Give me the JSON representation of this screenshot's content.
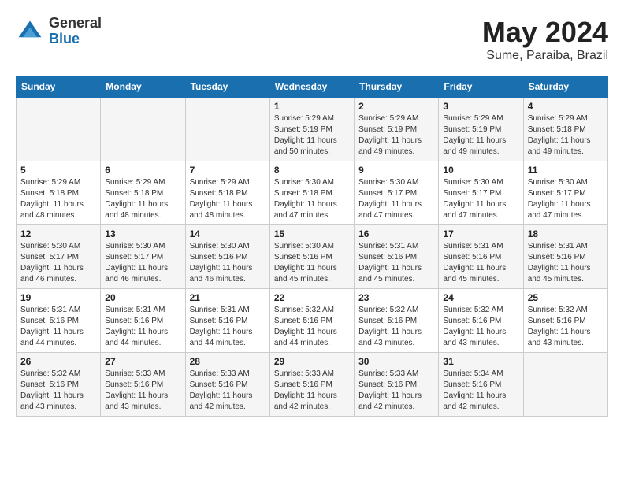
{
  "header": {
    "logo_general": "General",
    "logo_blue": "Blue",
    "month_title": "May 2024",
    "location": "Sume, Paraiba, Brazil"
  },
  "days_of_week": [
    "Sunday",
    "Monday",
    "Tuesday",
    "Wednesday",
    "Thursday",
    "Friday",
    "Saturday"
  ],
  "weeks": [
    [
      {
        "day": "",
        "info": ""
      },
      {
        "day": "",
        "info": ""
      },
      {
        "day": "",
        "info": ""
      },
      {
        "day": "1",
        "info": "Sunrise: 5:29 AM\nSunset: 5:19 PM\nDaylight: 11 hours\nand 50 minutes."
      },
      {
        "day": "2",
        "info": "Sunrise: 5:29 AM\nSunset: 5:19 PM\nDaylight: 11 hours\nand 49 minutes."
      },
      {
        "day": "3",
        "info": "Sunrise: 5:29 AM\nSunset: 5:19 PM\nDaylight: 11 hours\nand 49 minutes."
      },
      {
        "day": "4",
        "info": "Sunrise: 5:29 AM\nSunset: 5:18 PM\nDaylight: 11 hours\nand 49 minutes."
      }
    ],
    [
      {
        "day": "5",
        "info": "Sunrise: 5:29 AM\nSunset: 5:18 PM\nDaylight: 11 hours\nand 48 minutes."
      },
      {
        "day": "6",
        "info": "Sunrise: 5:29 AM\nSunset: 5:18 PM\nDaylight: 11 hours\nand 48 minutes."
      },
      {
        "day": "7",
        "info": "Sunrise: 5:29 AM\nSunset: 5:18 PM\nDaylight: 11 hours\nand 48 minutes."
      },
      {
        "day": "8",
        "info": "Sunrise: 5:30 AM\nSunset: 5:18 PM\nDaylight: 11 hours\nand 47 minutes."
      },
      {
        "day": "9",
        "info": "Sunrise: 5:30 AM\nSunset: 5:17 PM\nDaylight: 11 hours\nand 47 minutes."
      },
      {
        "day": "10",
        "info": "Sunrise: 5:30 AM\nSunset: 5:17 PM\nDaylight: 11 hours\nand 47 minutes."
      },
      {
        "day": "11",
        "info": "Sunrise: 5:30 AM\nSunset: 5:17 PM\nDaylight: 11 hours\nand 47 minutes."
      }
    ],
    [
      {
        "day": "12",
        "info": "Sunrise: 5:30 AM\nSunset: 5:17 PM\nDaylight: 11 hours\nand 46 minutes."
      },
      {
        "day": "13",
        "info": "Sunrise: 5:30 AM\nSunset: 5:17 PM\nDaylight: 11 hours\nand 46 minutes."
      },
      {
        "day": "14",
        "info": "Sunrise: 5:30 AM\nSunset: 5:16 PM\nDaylight: 11 hours\nand 46 minutes."
      },
      {
        "day": "15",
        "info": "Sunrise: 5:30 AM\nSunset: 5:16 PM\nDaylight: 11 hours\nand 45 minutes."
      },
      {
        "day": "16",
        "info": "Sunrise: 5:31 AM\nSunset: 5:16 PM\nDaylight: 11 hours\nand 45 minutes."
      },
      {
        "day": "17",
        "info": "Sunrise: 5:31 AM\nSunset: 5:16 PM\nDaylight: 11 hours\nand 45 minutes."
      },
      {
        "day": "18",
        "info": "Sunrise: 5:31 AM\nSunset: 5:16 PM\nDaylight: 11 hours\nand 45 minutes."
      }
    ],
    [
      {
        "day": "19",
        "info": "Sunrise: 5:31 AM\nSunset: 5:16 PM\nDaylight: 11 hours\nand 44 minutes."
      },
      {
        "day": "20",
        "info": "Sunrise: 5:31 AM\nSunset: 5:16 PM\nDaylight: 11 hours\nand 44 minutes."
      },
      {
        "day": "21",
        "info": "Sunrise: 5:31 AM\nSunset: 5:16 PM\nDaylight: 11 hours\nand 44 minutes."
      },
      {
        "day": "22",
        "info": "Sunrise: 5:32 AM\nSunset: 5:16 PM\nDaylight: 11 hours\nand 44 minutes."
      },
      {
        "day": "23",
        "info": "Sunrise: 5:32 AM\nSunset: 5:16 PM\nDaylight: 11 hours\nand 43 minutes."
      },
      {
        "day": "24",
        "info": "Sunrise: 5:32 AM\nSunset: 5:16 PM\nDaylight: 11 hours\nand 43 minutes."
      },
      {
        "day": "25",
        "info": "Sunrise: 5:32 AM\nSunset: 5:16 PM\nDaylight: 11 hours\nand 43 minutes."
      }
    ],
    [
      {
        "day": "26",
        "info": "Sunrise: 5:32 AM\nSunset: 5:16 PM\nDaylight: 11 hours\nand 43 minutes."
      },
      {
        "day": "27",
        "info": "Sunrise: 5:33 AM\nSunset: 5:16 PM\nDaylight: 11 hours\nand 43 minutes."
      },
      {
        "day": "28",
        "info": "Sunrise: 5:33 AM\nSunset: 5:16 PM\nDaylight: 11 hours\nand 42 minutes."
      },
      {
        "day": "29",
        "info": "Sunrise: 5:33 AM\nSunset: 5:16 PM\nDaylight: 11 hours\nand 42 minutes."
      },
      {
        "day": "30",
        "info": "Sunrise: 5:33 AM\nSunset: 5:16 PM\nDaylight: 11 hours\nand 42 minutes."
      },
      {
        "day": "31",
        "info": "Sunrise: 5:34 AM\nSunset: 5:16 PM\nDaylight: 11 hours\nand 42 minutes."
      },
      {
        "day": "",
        "info": ""
      }
    ]
  ]
}
